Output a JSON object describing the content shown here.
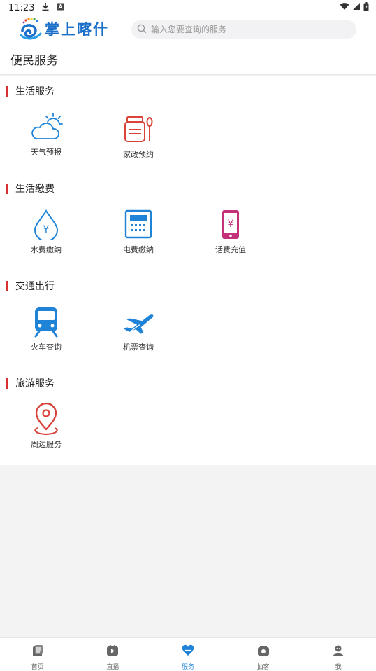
{
  "status_bar": {
    "time": "11:23",
    "icons": [
      "download-icon",
      "a-badge-icon",
      "wifi-icon",
      "signal-icon",
      "battery-icon"
    ]
  },
  "header": {
    "logo_text": "掌上喀什",
    "search_placeholder": "输入您要查询的服务"
  },
  "page": {
    "title": "便民服务"
  },
  "colors": {
    "accent_red": "#d73030",
    "icon_blue": "#1f84d8",
    "icon_red": "#d9433a",
    "icon_magenta": "#c4307a",
    "nav_active": "#1f84d8"
  },
  "sections": [
    {
      "title": "生活服务",
      "items": [
        {
          "label": "天气预报",
          "icon": "weather-icon"
        },
        {
          "label": "家政预约",
          "icon": "housekeeping-icon"
        }
      ]
    },
    {
      "title": "生活缴费",
      "items": [
        {
          "label": "水费缴纳",
          "icon": "water-bill-icon"
        },
        {
          "label": "电费缴纳",
          "icon": "electricity-bill-icon"
        },
        {
          "label": "话费充值",
          "icon": "phone-recharge-icon"
        }
      ]
    },
    {
      "title": "交通出行",
      "items": [
        {
          "label": "火车查询",
          "icon": "train-icon"
        },
        {
          "label": "机票查询",
          "icon": "airplane-icon"
        }
      ]
    },
    {
      "title": "旅游服务",
      "items": [
        {
          "label": "周边服务",
          "icon": "location-pin-icon"
        }
      ]
    }
  ],
  "bottom_nav": {
    "active": "服务",
    "items": [
      {
        "label": "首页",
        "icon": "home-news-icon"
      },
      {
        "label": "直播",
        "icon": "live-play-icon"
      },
      {
        "label": "服务",
        "icon": "heart-service-icon"
      },
      {
        "label": "拍客",
        "icon": "camera-icon"
      },
      {
        "label": "我",
        "icon": "user-profile-icon"
      }
    ]
  }
}
